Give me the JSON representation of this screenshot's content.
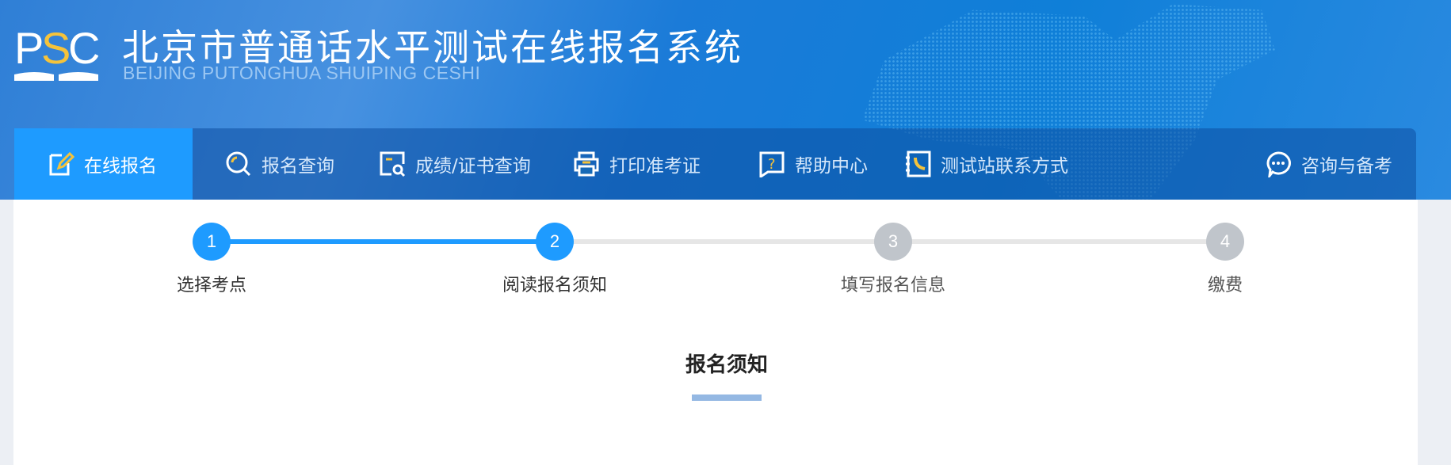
{
  "header": {
    "logo_text": "PSC",
    "title": "北京市普通话水平测试在线报名系统",
    "subtitle": "BEIJING PUTONGHUA SHUIPING CESHI"
  },
  "nav": {
    "items": [
      {
        "label": "在线报名",
        "icon": "edit-icon",
        "active": true
      },
      {
        "label": "报名查询",
        "icon": "search-icon"
      },
      {
        "label": "成绩/证书查询",
        "icon": "certificate-search-icon"
      },
      {
        "label": "打印准考证",
        "icon": "printer-icon"
      },
      {
        "label": "帮助中心",
        "icon": "help-icon"
      },
      {
        "label": "测试站联系方式",
        "icon": "phone-book-icon"
      },
      {
        "label": "咨询与备考",
        "icon": "chat-icon"
      }
    ]
  },
  "steps": [
    {
      "number": "1",
      "label": "选择考点",
      "status": "done"
    },
    {
      "number": "2",
      "label": "阅读报名须知",
      "status": "current"
    },
    {
      "number": "3",
      "label": "填写报名信息",
      "status": "pending"
    },
    {
      "number": "4",
      "label": "缴费",
      "status": "pending"
    }
  ],
  "section": {
    "title": "报名须知"
  },
  "colors": {
    "accent": "#1e9bff",
    "pending": "#c0c5cb",
    "track": "#e6e6e6",
    "underline": "#94b8e3"
  }
}
